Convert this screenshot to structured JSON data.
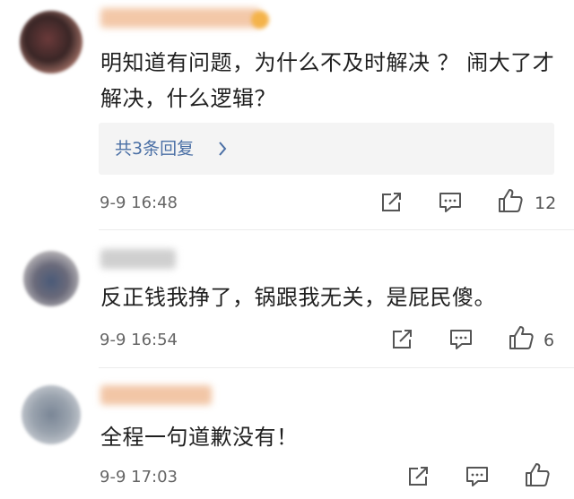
{
  "comments": [
    {
      "text": "明知道有问题，为什么不及时解决 ？ 闹大了才解决，什么逻辑？",
      "replies_label": "共3条回复",
      "timestamp": "9-9 16:48",
      "like_count": "12"
    },
    {
      "text": "反正钱我挣了，锅跟我无关，是屁民傻。",
      "timestamp": "9-9 16:54",
      "like_count": "6"
    },
    {
      "text": "全程一句道歉没有！",
      "timestamp": "9-9 17:03",
      "like_count": ""
    }
  ],
  "icons": {
    "share": "share-icon",
    "comment": "comment-icon",
    "like": "like-icon",
    "reply_chevron": "chevron-right-icon"
  },
  "colors": {
    "link": "#4a6fa5",
    "reply_bg": "#f4f4f4",
    "meta_text": "#666666"
  }
}
